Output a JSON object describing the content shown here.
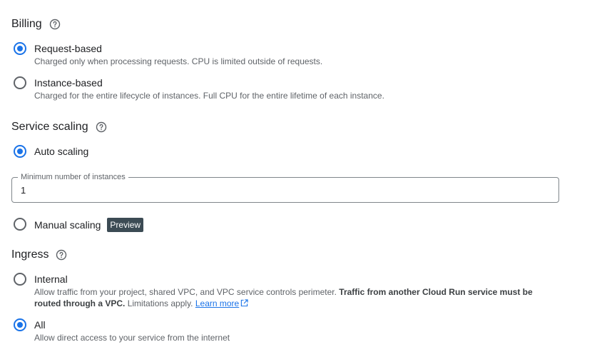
{
  "billing": {
    "title": "Billing",
    "options": [
      {
        "label": "Request-based",
        "description": "Charged only when processing requests. CPU is limited outside of requests.",
        "checked": true
      },
      {
        "label": "Instance-based",
        "description": "Charged for the entire lifecycle of instances. Full CPU for the entire lifetime of each instance.",
        "checked": false
      }
    ]
  },
  "scaling": {
    "title": "Service scaling",
    "auto_label": "Auto scaling",
    "min_instances_label": "Minimum number of instances",
    "min_instances_value": "1",
    "manual_label": "Manual scaling",
    "preview_badge": "Preview"
  },
  "ingress": {
    "title": "Ingress",
    "internal_label": "Internal",
    "internal_desc_part1": "Allow traffic from your project, shared VPC, and VPC service controls perimeter.",
    "internal_desc_bold": "Traffic from another Cloud Run service must be routed through a VPC.",
    "internal_desc_part2": "Limitations apply.",
    "learn_more": "Learn more",
    "all_label": "All",
    "all_desc": "Allow direct access to your service from the internet"
  },
  "colors": {
    "accent": "#1a73e8",
    "badge_bg": "#3c4b54",
    "text_secondary": "#5f6368"
  },
  "icons": {
    "help": "help-circle-icon",
    "external_link": "open-in-new-icon"
  }
}
